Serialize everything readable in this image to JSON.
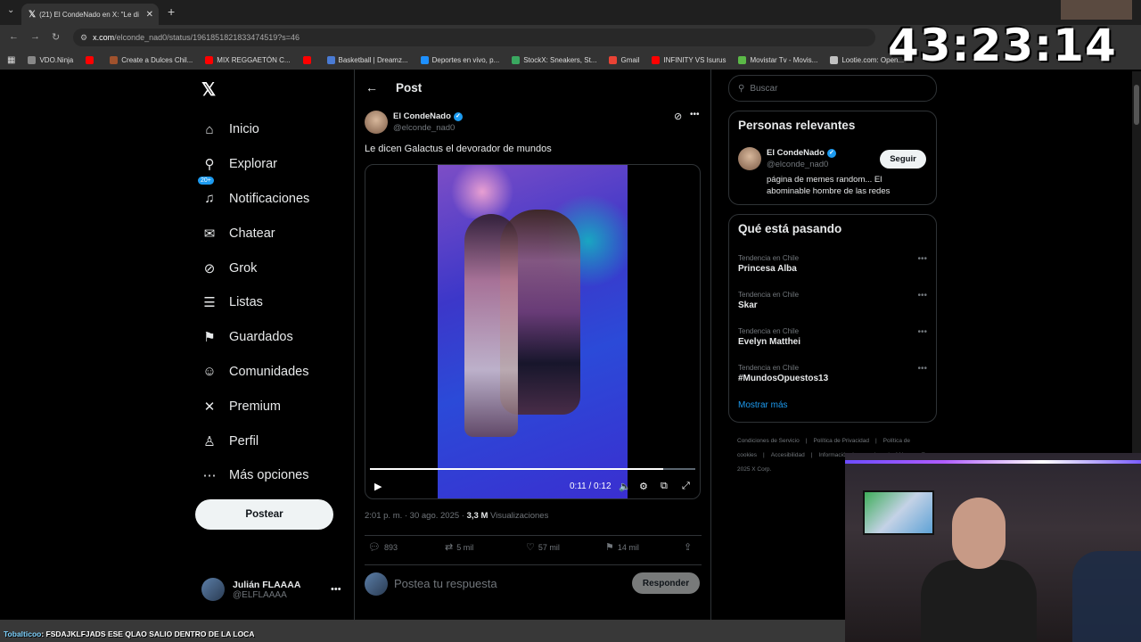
{
  "browser": {
    "tab_title": "(21) El CondeNado en X: \"Le di",
    "url_host": "x.com",
    "url_path": "/elconde_nad0/status/1961851821833474519?s=46",
    "bookmarks": [
      {
        "label": "VDO.Ninja",
        "color": "#888888"
      },
      {
        "label": "",
        "color": "#ff0000"
      },
      {
        "label": "Create a Dulces Chil...",
        "color": "#a0522d"
      },
      {
        "label": "MIX REGGAETÓN C...",
        "color": "#ff0000"
      },
      {
        "label": "",
        "color": "#ff0000"
      },
      {
        "label": "Basketball | Dreamz...",
        "color": "#4a7bd4"
      },
      {
        "label": "Deportes en vivo, p...",
        "color": "#1e90ff"
      },
      {
        "label": "StockX: Sneakers, St...",
        "color": "#3aa860"
      },
      {
        "label": "Gmail",
        "color": "#ea4335"
      },
      {
        "label": "INFINITY VS Isurus",
        "color": "#ff0000"
      },
      {
        "label": "Movistar Tv - Movis...",
        "color": "#5bb947"
      },
      {
        "label": "Lootie.com: Open...",
        "color": "#c0c0c0"
      }
    ]
  },
  "overlay": {
    "timer": "43:23:14",
    "chat_user": "Tobalticoo",
    "chat_text": ": FSDAJKLFJADS ESE QLAO SALIO DENTRO DE LA LOCA"
  },
  "sidebar": {
    "items": [
      {
        "label": "Inicio",
        "icon": "home-icon",
        "glyph": "⌂"
      },
      {
        "label": "Explorar",
        "icon": "search-icon",
        "glyph": "⚲"
      },
      {
        "label": "Notificaciones",
        "icon": "bell-icon",
        "glyph": "♫",
        "badge": "20+"
      },
      {
        "label": "Chatear",
        "icon": "mail-icon",
        "glyph": "✉"
      },
      {
        "label": "Grok",
        "icon": "grok-icon",
        "glyph": "⊘"
      },
      {
        "label": "Listas",
        "icon": "list-icon",
        "glyph": "☰"
      },
      {
        "label": "Guardados",
        "icon": "bookmark-icon",
        "glyph": "⚑"
      },
      {
        "label": "Comunidades",
        "icon": "communities-icon",
        "glyph": "☺"
      },
      {
        "label": "Premium",
        "icon": "x-premium-icon",
        "glyph": "✕"
      },
      {
        "label": "Perfil",
        "icon": "profile-icon",
        "glyph": "♙"
      },
      {
        "label": "Más opciones",
        "icon": "more-options-icon",
        "glyph": "⋯"
      }
    ],
    "post_button": "Postear",
    "account_name": "Julián FLAAAA",
    "account_handle": "@ELFLAAAA"
  },
  "post": {
    "header_title": "Post",
    "author_name": "El CondeNado",
    "author_handle": "@elconde_nad0",
    "text": "Le dicen Galactus el devorador de mundos",
    "video_time": "0:11 / 0:12",
    "video_progress": 0.9,
    "timestamp": "2:01 p. m. · 30 ago. 2025 · ",
    "views_count": "3,3 M",
    "views_label": " Visualizaciones",
    "replies": "893",
    "reposts": "5 mil",
    "likes": "57 mil",
    "bookmarks": "14 mil",
    "reply_placeholder": "Postea tu respuesta",
    "reply_button": "Responder"
  },
  "right": {
    "search_placeholder": "Buscar",
    "relevant_title": "Personas relevantes",
    "relevant_name": "El CondeNado",
    "relevant_handle": "@elconde_nad0",
    "follow_label": "Seguir",
    "relevant_bio": "página de memes random... El abominable hombre de las redes",
    "trending_title": "Qué está pasando",
    "trends": [
      {
        "category": "Tendencia en Chile",
        "name": "Princesa Alba"
      },
      {
        "category": "Tendencia en Chile",
        "name": "Skar"
      },
      {
        "category": "Tendencia en Chile",
        "name": "Evelyn Matthei"
      },
      {
        "category": "Tendencia en Chile",
        "name": "#MundosOpuestos13"
      }
    ],
    "show_more": "Mostrar más",
    "footer": [
      "Condiciones de Servicio",
      "|",
      "Política de Privacidad",
      "|",
      "Política de cookies",
      "|",
      "Accesibilidad",
      "|",
      "Información de anuncios",
      "|",
      "Más op",
      "© 2025 X Corp."
    ]
  }
}
